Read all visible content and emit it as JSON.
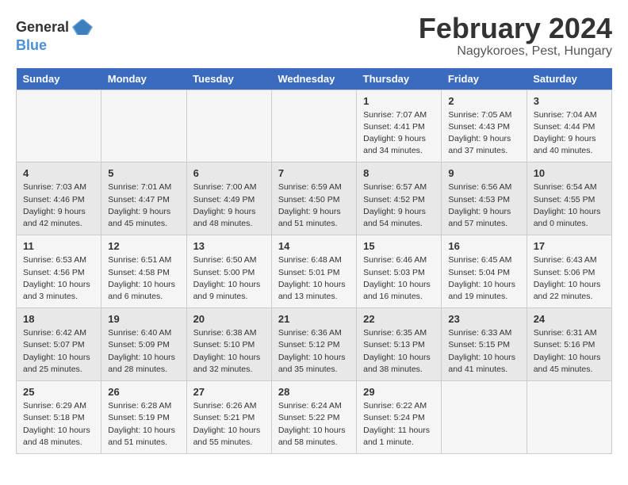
{
  "header": {
    "logo_general": "General",
    "logo_blue": "Blue",
    "month_title": "February 2024",
    "location": "Nagykoroes, Pest, Hungary"
  },
  "calendar": {
    "weekdays": [
      "Sunday",
      "Monday",
      "Tuesday",
      "Wednesday",
      "Thursday",
      "Friday",
      "Saturday"
    ],
    "weeks": [
      {
        "days": [
          {
            "num": "",
            "info": ""
          },
          {
            "num": "",
            "info": ""
          },
          {
            "num": "",
            "info": ""
          },
          {
            "num": "",
            "info": ""
          },
          {
            "num": "1",
            "info": "Sunrise: 7:07 AM\nSunset: 4:41 PM\nDaylight: 9 hours\nand 34 minutes."
          },
          {
            "num": "2",
            "info": "Sunrise: 7:05 AM\nSunset: 4:43 PM\nDaylight: 9 hours\nand 37 minutes."
          },
          {
            "num": "3",
            "info": "Sunrise: 7:04 AM\nSunset: 4:44 PM\nDaylight: 9 hours\nand 40 minutes."
          }
        ]
      },
      {
        "days": [
          {
            "num": "4",
            "info": "Sunrise: 7:03 AM\nSunset: 4:46 PM\nDaylight: 9 hours\nand 42 minutes."
          },
          {
            "num": "5",
            "info": "Sunrise: 7:01 AM\nSunset: 4:47 PM\nDaylight: 9 hours\nand 45 minutes."
          },
          {
            "num": "6",
            "info": "Sunrise: 7:00 AM\nSunset: 4:49 PM\nDaylight: 9 hours\nand 48 minutes."
          },
          {
            "num": "7",
            "info": "Sunrise: 6:59 AM\nSunset: 4:50 PM\nDaylight: 9 hours\nand 51 minutes."
          },
          {
            "num": "8",
            "info": "Sunrise: 6:57 AM\nSunset: 4:52 PM\nDaylight: 9 hours\nand 54 minutes."
          },
          {
            "num": "9",
            "info": "Sunrise: 6:56 AM\nSunset: 4:53 PM\nDaylight: 9 hours\nand 57 minutes."
          },
          {
            "num": "10",
            "info": "Sunrise: 6:54 AM\nSunset: 4:55 PM\nDaylight: 10 hours\nand 0 minutes."
          }
        ]
      },
      {
        "days": [
          {
            "num": "11",
            "info": "Sunrise: 6:53 AM\nSunset: 4:56 PM\nDaylight: 10 hours\nand 3 minutes."
          },
          {
            "num": "12",
            "info": "Sunrise: 6:51 AM\nSunset: 4:58 PM\nDaylight: 10 hours\nand 6 minutes."
          },
          {
            "num": "13",
            "info": "Sunrise: 6:50 AM\nSunset: 5:00 PM\nDaylight: 10 hours\nand 9 minutes."
          },
          {
            "num": "14",
            "info": "Sunrise: 6:48 AM\nSunset: 5:01 PM\nDaylight: 10 hours\nand 13 minutes."
          },
          {
            "num": "15",
            "info": "Sunrise: 6:46 AM\nSunset: 5:03 PM\nDaylight: 10 hours\nand 16 minutes."
          },
          {
            "num": "16",
            "info": "Sunrise: 6:45 AM\nSunset: 5:04 PM\nDaylight: 10 hours\nand 19 minutes."
          },
          {
            "num": "17",
            "info": "Sunrise: 6:43 AM\nSunset: 5:06 PM\nDaylight: 10 hours\nand 22 minutes."
          }
        ]
      },
      {
        "days": [
          {
            "num": "18",
            "info": "Sunrise: 6:42 AM\nSunset: 5:07 PM\nDaylight: 10 hours\nand 25 minutes."
          },
          {
            "num": "19",
            "info": "Sunrise: 6:40 AM\nSunset: 5:09 PM\nDaylight: 10 hours\nand 28 minutes."
          },
          {
            "num": "20",
            "info": "Sunrise: 6:38 AM\nSunset: 5:10 PM\nDaylight: 10 hours\nand 32 minutes."
          },
          {
            "num": "21",
            "info": "Sunrise: 6:36 AM\nSunset: 5:12 PM\nDaylight: 10 hours\nand 35 minutes."
          },
          {
            "num": "22",
            "info": "Sunrise: 6:35 AM\nSunset: 5:13 PM\nDaylight: 10 hours\nand 38 minutes."
          },
          {
            "num": "23",
            "info": "Sunrise: 6:33 AM\nSunset: 5:15 PM\nDaylight: 10 hours\nand 41 minutes."
          },
          {
            "num": "24",
            "info": "Sunrise: 6:31 AM\nSunset: 5:16 PM\nDaylight: 10 hours\nand 45 minutes."
          }
        ]
      },
      {
        "days": [
          {
            "num": "25",
            "info": "Sunrise: 6:29 AM\nSunset: 5:18 PM\nDaylight: 10 hours\nand 48 minutes."
          },
          {
            "num": "26",
            "info": "Sunrise: 6:28 AM\nSunset: 5:19 PM\nDaylight: 10 hours\nand 51 minutes."
          },
          {
            "num": "27",
            "info": "Sunrise: 6:26 AM\nSunset: 5:21 PM\nDaylight: 10 hours\nand 55 minutes."
          },
          {
            "num": "28",
            "info": "Sunrise: 6:24 AM\nSunset: 5:22 PM\nDaylight: 10 hours\nand 58 minutes."
          },
          {
            "num": "29",
            "info": "Sunrise: 6:22 AM\nSunset: 5:24 PM\nDaylight: 11 hours\nand 1 minute."
          },
          {
            "num": "",
            "info": ""
          },
          {
            "num": "",
            "info": ""
          }
        ]
      }
    ]
  }
}
